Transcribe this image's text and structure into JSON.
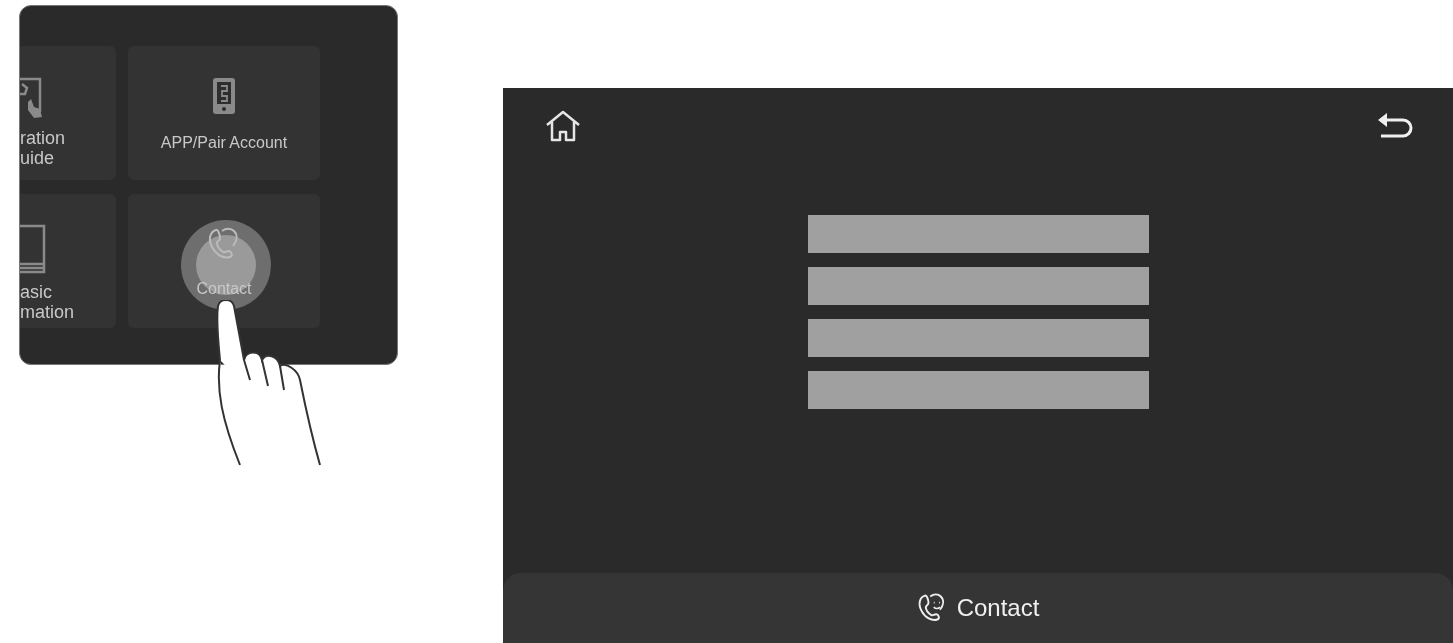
{
  "menu_panel": {
    "tiles": [
      {
        "kind": "guide",
        "label": "ration\nuide"
      },
      {
        "kind": "phone",
        "label": "APP/Pair Account"
      },
      {
        "kind": "book",
        "label": "asic\nmation"
      },
      {
        "kind": "contact",
        "label": "Contact",
        "touched": true
      }
    ]
  },
  "contact_screen": {
    "title": "Contact"
  }
}
